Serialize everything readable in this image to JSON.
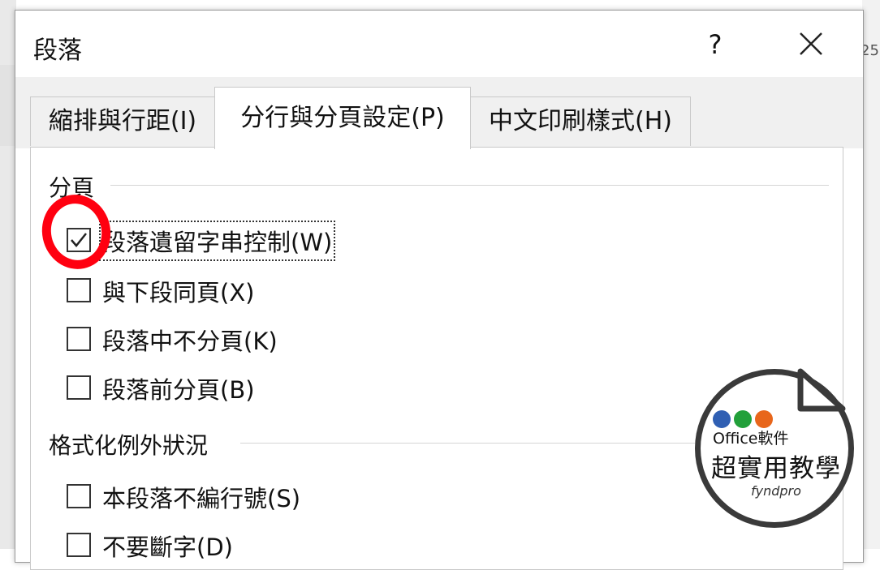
{
  "background": {
    "right_number": "25"
  },
  "dialog": {
    "title": "段落",
    "help_label": "?",
    "tabs": [
      {
        "label": "縮排與行距(I)",
        "selected": false
      },
      {
        "label": "分行與分頁設定(P)",
        "selected": true
      },
      {
        "label": "中文印刷樣式(H)",
        "selected": false
      }
    ],
    "pagination": {
      "title": "分頁",
      "items": [
        {
          "label": "段落遺留字串控制(W)",
          "checked": true
        },
        {
          "label": "與下段同頁(X)",
          "checked": false
        },
        {
          "label": "段落中不分頁(K)",
          "checked": false
        },
        {
          "label": "段落前分頁(B)",
          "checked": false
        }
      ]
    },
    "formatting_exceptions": {
      "title": "格式化例外狀況",
      "items": [
        {
          "label": "本段落不編行號(S)",
          "checked": false
        },
        {
          "label": "不要斷字(D)",
          "checked": false
        }
      ]
    }
  },
  "badge": {
    "line1": "Office軟件",
    "line2": "超實用教學",
    "logo": "fyndpro",
    "colors": {
      "dot1": "#2f5fb3",
      "dot2": "#22a03a",
      "dot3": "#e8661b",
      "highlight": "#ff0010"
    }
  }
}
